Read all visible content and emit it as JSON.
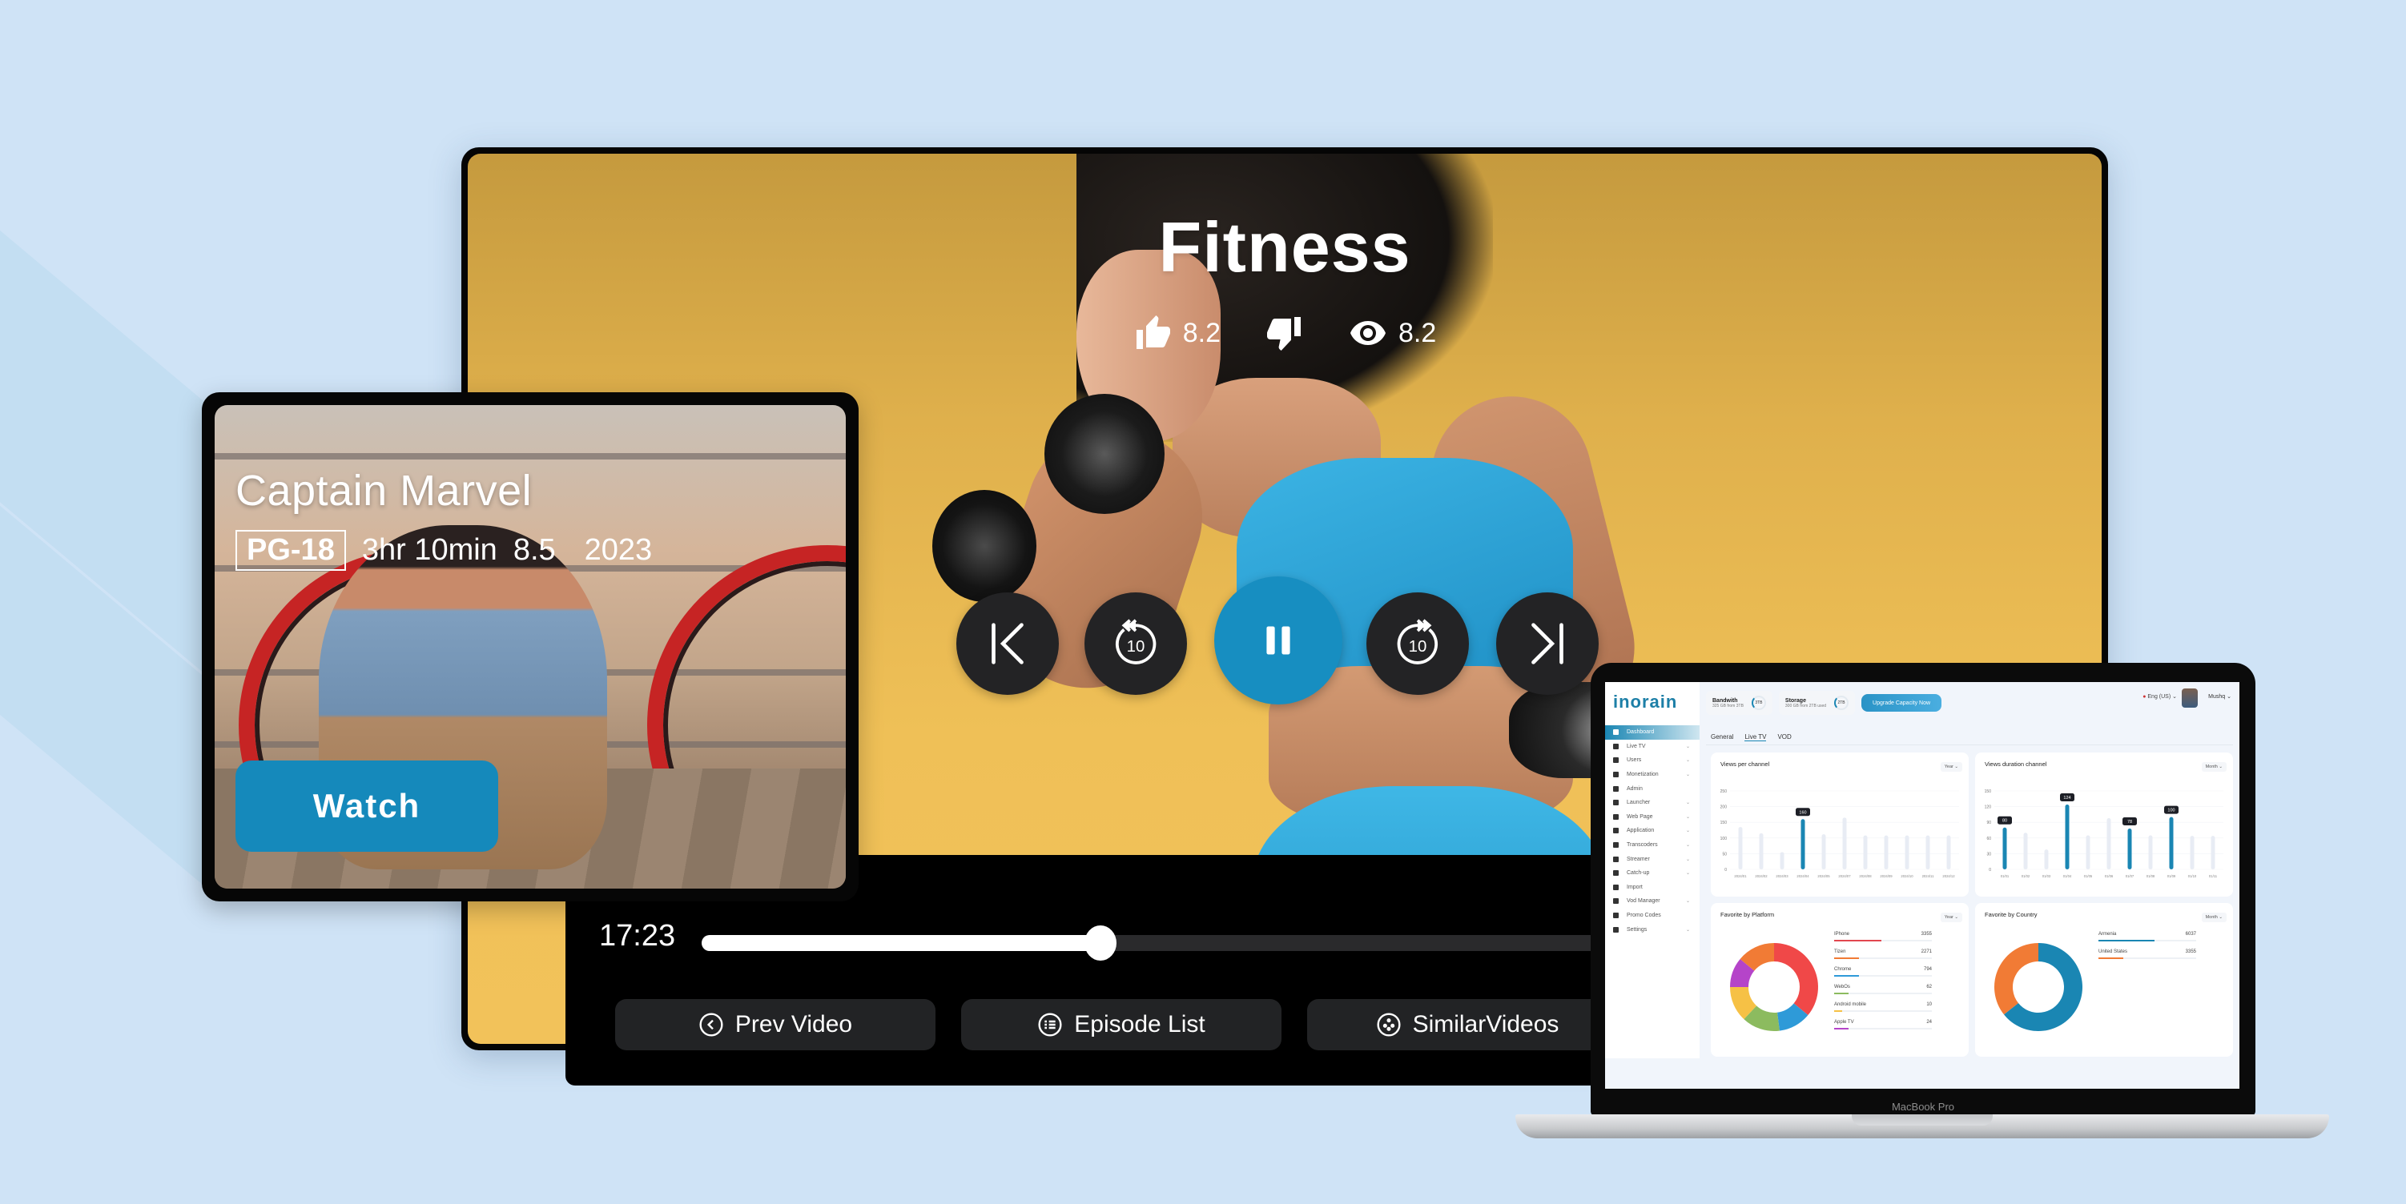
{
  "player": {
    "title": "Fitness",
    "likes": "8.2",
    "views": "8.2",
    "current_time": "17:23",
    "progress": 0.415,
    "buttons": {
      "prev_video": "Prev Video",
      "episode_list": "Episode List",
      "similar_videos": "SimilarVideos"
    },
    "skip_seconds": "10"
  },
  "card": {
    "title": "Captain Marvel",
    "rating": "PG-18",
    "duration": "3hr 10min",
    "score": "8.5",
    "year": "2023",
    "watch_label": "Watch"
  },
  "laptop": {
    "model_label": "MacBook Pro",
    "dashboard": {
      "logo": "inorain",
      "nav": [
        {
          "label": "Dashboard",
          "active": true,
          "expandable": false
        },
        {
          "label": "Live TV",
          "expandable": true
        },
        {
          "label": "Users",
          "expandable": true
        },
        {
          "label": "Monetization",
          "expandable": true
        },
        {
          "label": "Admin",
          "expandable": false
        },
        {
          "label": "Launcher",
          "expandable": true
        },
        {
          "label": "Web Page",
          "expandable": true
        },
        {
          "label": "Application",
          "expandable": true
        },
        {
          "label": "Transcoders",
          "expandable": true
        },
        {
          "label": "Streamer",
          "expandable": true
        },
        {
          "label": "Catch-up",
          "expandable": true
        },
        {
          "label": "Import",
          "expandable": false
        },
        {
          "label": "Vod Manager",
          "expandable": true
        },
        {
          "label": "Promo Codes",
          "expandable": false
        },
        {
          "label": "Settings",
          "expandable": true
        }
      ],
      "bandwidth": {
        "title": "Bandwith",
        "sub": "325 GB from 3TB",
        "ring": "3TB"
      },
      "storage": {
        "title": "Storage",
        "sub": "300 GB from 2TB used",
        "ring": "2TB"
      },
      "upgrade_label": "Upgrade Capacity Now",
      "language": "Eng (US)",
      "user": "Mushq",
      "tabs": [
        "General",
        "Live TV",
        "VOD"
      ],
      "active_tab": "Live TV",
      "accent": "#1a86b3"
    }
  },
  "chart_data": [
    {
      "type": "bar",
      "title": "Views per channel",
      "period": "Year",
      "categories": [
        "2024/01",
        "2024/02",
        "2024/03",
        "2024/04",
        "2024/05",
        "2024/07",
        "2024/08",
        "2024/09",
        "2024/10",
        "2024/11",
        "2024/12"
      ],
      "values": [
        135,
        115,
        55,
        160,
        112,
        165,
        108,
        108,
        108,
        108,
        108
      ],
      "highlighted": [
        3
      ],
      "tooltips": {
        "3": "160"
      },
      "ylim": [
        0,
        250
      ],
      "yticks": [
        0,
        50,
        100,
        150,
        200,
        250
      ],
      "colors": {
        "highlight": "#1a86b3",
        "base": "#e8ecf4"
      }
    },
    {
      "type": "bar",
      "title": "Views duration channel",
      "period": "Month",
      "categories": [
        "01/01",
        "01/02",
        "01/03",
        "01/04",
        "01/05",
        "01/06",
        "01/07",
        "01/08",
        "01/09",
        "01/10",
        "01/11"
      ],
      "values": [
        80,
        70,
        38,
        124,
        65,
        98,
        78,
        65,
        100,
        64,
        64
      ],
      "highlighted": [
        0,
        3,
        6,
        8
      ],
      "tooltips": {
        "0": "80",
        "3": "124",
        "6": "78",
        "8": "100"
      },
      "ylim": [
        0,
        150
      ],
      "yticks": [
        0,
        30,
        60,
        90,
        120,
        150
      ],
      "colors": {
        "highlight": "#1a86b3",
        "base": "#e8ecf4"
      }
    },
    {
      "type": "pie",
      "title": "Favorite by Platform",
      "period": "Year",
      "labels": [
        "IPhone",
        "Tizen",
        "Chrome",
        "WebOs",
        "Android mobile",
        "Apple TV"
      ],
      "values": [
        3355,
        2271,
        794,
        62,
        10,
        24
      ],
      "bar_fraction": [
        0.48,
        0.25,
        0.25,
        0.15,
        0.08,
        0.15
      ],
      "donut_slices": [
        {
          "color": "#f04848",
          "share": 0.36
        },
        {
          "color": "#2e9ad8",
          "share": 0.12
        },
        {
          "color": "#8cbb5f",
          "share": 0.14
        },
        {
          "color": "#f6c145",
          "share": 0.13
        },
        {
          "color": "#b544c9",
          "share": 0.11
        },
        {
          "color": "#f17b35",
          "share": 0.14
        }
      ],
      "colors": [
        "#e2474f",
        "#f17b35",
        "#2e9ad8",
        "#8cbb5f",
        "#f6c145",
        "#b544c9"
      ]
    },
    {
      "type": "pie",
      "title": "Favorite by Country",
      "period": "Month",
      "labels": [
        "Armenia",
        "United States"
      ],
      "values": [
        6037,
        3355
      ],
      "bar_fraction": [
        0.57,
        0.25
      ],
      "colors": [
        "#1a86b3",
        "#f17b35"
      ]
    }
  ]
}
